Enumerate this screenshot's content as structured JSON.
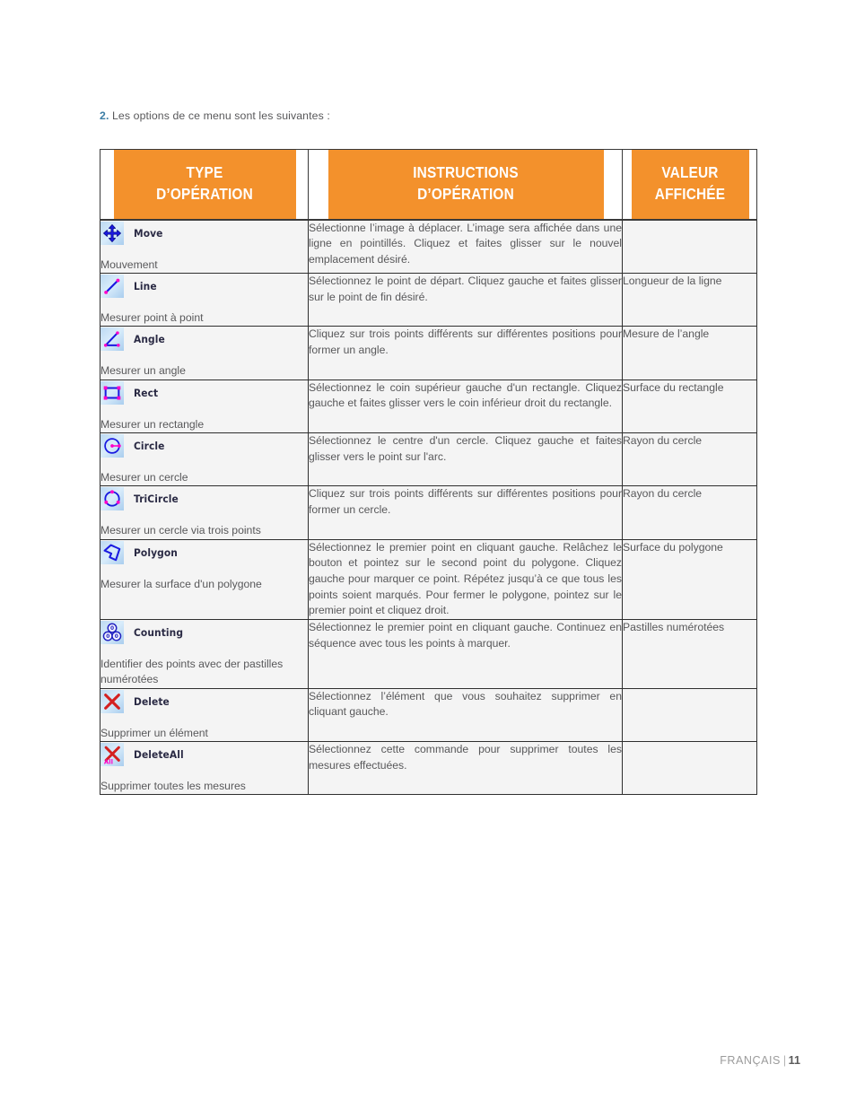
{
  "intro": {
    "number": "2.",
    "text": " Les options de ce menu sont les suivantes :"
  },
  "colors": {
    "header_orange": "#f3912c",
    "header_text": "#ffffff",
    "cell_background": "#f4f4f4",
    "border": "#2f2f2f",
    "body_text": "#58585a",
    "number_accent": "#3d7ea6",
    "icon_blue": "#1a1ae0",
    "icon_magenta": "#ff00c8",
    "icon_red": "#d42020"
  },
  "table": {
    "headers": [
      {
        "line1": "TYPE",
        "line2": "D’OPÉRATION"
      },
      {
        "line1": "INSTRUCTIONS",
        "line2": "D’OPÉRATION"
      },
      {
        "line1": "VALEUR",
        "line2": "AFFICHÉE"
      }
    ],
    "rows": [
      {
        "icon": "move-icon",
        "tool": "Move",
        "type_desc": "Mouvement",
        "instructions": "Sélectionne l’image à déplacer. L’image sera affichée dans une ligne en pointillés. Cliquez et faites glisser sur le nouvel emplacement désiré.",
        "value": ""
      },
      {
        "icon": "line-icon",
        "tool": "Line",
        "type_desc": "Mesurer point à point",
        "instructions": "Sélectionnez le point de départ. Cliquez gauche et faites glisser sur le point de fin désiré.",
        "value": "Longueur de la ligne"
      },
      {
        "icon": "angle-icon",
        "tool": "Angle",
        "type_desc": "Mesurer un angle",
        "instructions": "Cliquez sur trois points différents sur différentes positions pour former un angle.",
        "value": "Mesure de l’angle"
      },
      {
        "icon": "rect-icon",
        "tool": "Rect",
        "type_desc": "Mesurer un rectangle",
        "instructions": "Sélectionnez le coin supérieur gauche d'un rectangle. Cliquez gauche et faites glisser vers le coin inférieur droit du rectangle.",
        "value": "Surface du rectangle"
      },
      {
        "icon": "circle-icon",
        "tool": "Circle",
        "type_desc": "Mesurer un cercle",
        "instructions": "Sélectionnez le centre d'un cercle. Cliquez gauche et faites glisser vers le point sur l'arc.",
        "value": "Rayon du cercle"
      },
      {
        "icon": "tricircle-icon",
        "tool": "TriCircle",
        "type_desc": "Mesurer un cercle via trois points",
        "instructions": "Cliquez sur trois points différents sur différentes positions pour former un cercle.",
        "value": "Rayon du cercle"
      },
      {
        "icon": "polygon-icon",
        "tool": "Polygon",
        "type_desc": "Mesurer la surface d'un polygone",
        "instructions": "Sélectionnez le premier point en cliquant gauche. Relâchez le bouton et pointez sur le second point du polygone. Cliquez gauche pour marquer ce point. Répétez jusqu’à ce que tous les points soient marqués. Pour fermer le polygone, pointez sur le premier point et cliquez droit.",
        "value": "Surface du polygone"
      },
      {
        "icon": "counting-icon",
        "tool": "Counting",
        "type_desc": "Identifier des points avec der pastilles numérotées",
        "instructions": "Sélectionnez le premier point en cliquant gauche. Continuez en séquence avec tous les points à marquer.",
        "value": "Pastilles numérotées"
      },
      {
        "icon": "delete-icon",
        "tool": "Delete",
        "type_desc": "Supprimer un élément",
        "instructions": "Sélectionnez l’élément que vous souhaitez supprimer en cliquant gauche.",
        "value": ""
      },
      {
        "icon": "delete-all-icon",
        "tool": "DeleteAll",
        "type_desc": "Supprimer toutes les mesures",
        "instructions": "Sélectionnez cette commande pour supprimer toutes les mesures effectuées.",
        "value": ""
      }
    ]
  },
  "footer": {
    "language": "FRANÇAIS",
    "separator": "|",
    "page_number": "11"
  }
}
